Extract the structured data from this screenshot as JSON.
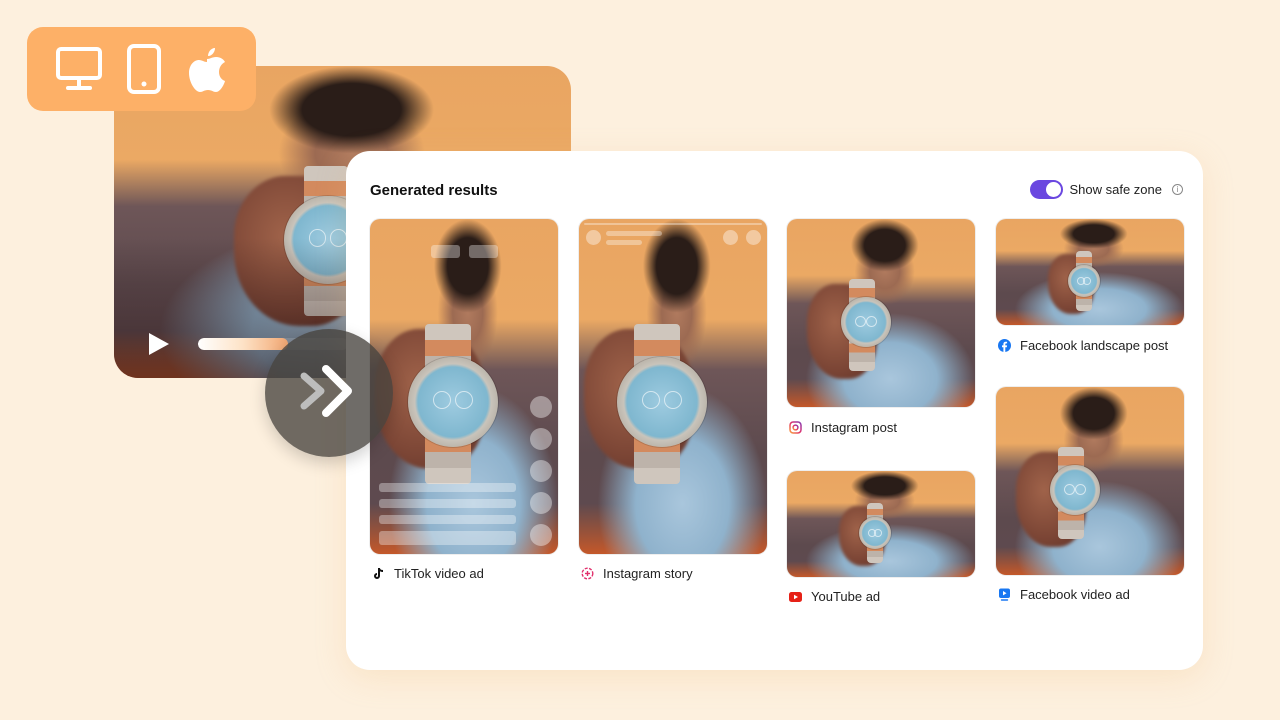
{
  "device_badge": {
    "icons": [
      "desktop-monitor-icon",
      "tablet-icon",
      "apple-icon"
    ],
    "color": "#fdb067"
  },
  "source_video": {
    "play_icon": "play-icon",
    "progress_fraction": 0.6
  },
  "convert_button": {
    "icon": "double-chevron-right-icon"
  },
  "results": {
    "title": "Generated results",
    "safe_zone": {
      "label": "Show safe zone",
      "enabled": true,
      "toggle_color": "#6a47e0",
      "info_icon": "i"
    },
    "items": [
      {
        "label": "TikTok video ad",
        "icon": "tiktok-icon",
        "icon_color": "#111111"
      },
      {
        "label": "Instagram story",
        "icon": "instagram-story-icon",
        "icon_color": "#e1306c"
      },
      {
        "label": "Instagram post",
        "icon": "instagram-icon",
        "icon_color": "#c13584"
      },
      {
        "label": "YouTube ad",
        "icon": "youtube-icon",
        "icon_color": "#e62117"
      },
      {
        "label": "Facebook landscape post",
        "icon": "facebook-icon",
        "icon_color": "#1877f2"
      },
      {
        "label": "Facebook video ad",
        "icon": "facebook-video-icon",
        "icon_color": "#1877f2"
      }
    ]
  }
}
